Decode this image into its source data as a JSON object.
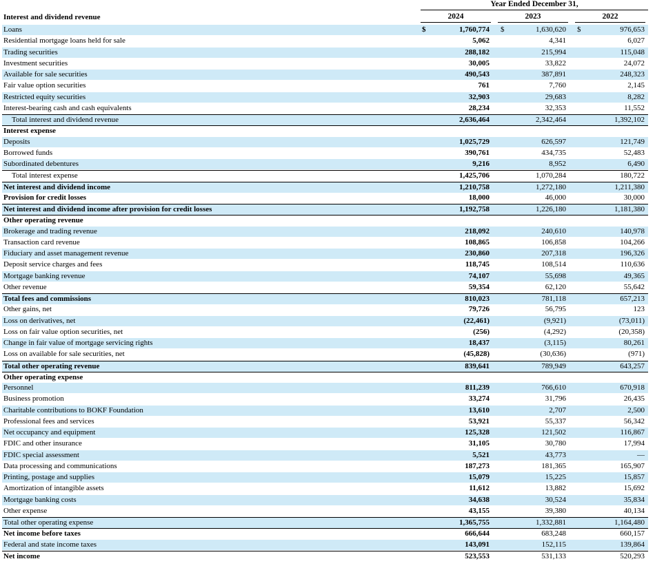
{
  "header": {
    "section_title": "Interest and dividend revenue",
    "period": "Year Ended December 31,",
    "years": [
      "2024",
      "2023",
      "2022"
    ],
    "dollar_sign": "$"
  },
  "rows": [
    {
      "label": "Loans",
      "v": [
        "1,760,774",
        "1,630,620",
        "976,653"
      ],
      "dollar": true
    },
    {
      "label": "Residential mortgage loans held for sale",
      "v": [
        "5,062",
        "4,341",
        "6,027"
      ]
    },
    {
      "label": "Trading securities",
      "v": [
        "288,182",
        "215,994",
        "115,048"
      ]
    },
    {
      "label": "Investment securities",
      "v": [
        "30,005",
        "33,822",
        "24,072"
      ]
    },
    {
      "label": "Available for sale securities",
      "v": [
        "490,543",
        "387,891",
        "248,323"
      ]
    },
    {
      "label": "Fair value option securities",
      "v": [
        "761",
        "7,760",
        "2,145"
      ]
    },
    {
      "label": "Restricted equity securities",
      "v": [
        "32,903",
        "29,683",
        "8,282"
      ]
    },
    {
      "label": "Interest-bearing cash and cash equivalents",
      "v": [
        "28,234",
        "32,353",
        "11,552"
      ]
    },
    {
      "label": "Total interest and dividend revenue",
      "v": [
        "2,636,464",
        "2,342,464",
        "1,392,102"
      ],
      "indent": true,
      "topline": true
    },
    {
      "label": "Interest expense",
      "v": [
        "",
        "",
        ""
      ],
      "bold": true,
      "topline": true
    },
    {
      "label": "Deposits",
      "v": [
        "1,025,729",
        "626,597",
        "121,749"
      ]
    },
    {
      "label": "Borrowed funds",
      "v": [
        "390,761",
        "434,735",
        "52,483"
      ]
    },
    {
      "label": "Subordinated debentures",
      "v": [
        "9,216",
        "8,952",
        "6,490"
      ]
    },
    {
      "label": "Total interest expense",
      "v": [
        "1,425,706",
        "1,070,284",
        "180,722"
      ],
      "indent": true,
      "topline": true
    },
    {
      "label": "Net interest and dividend income",
      "v": [
        "1,210,758",
        "1,272,180",
        "1,211,380"
      ],
      "bold": true,
      "topline": true
    },
    {
      "label": "Provision for credit losses",
      "v": [
        "18,000",
        "46,000",
        "30,000"
      ],
      "bold": true
    },
    {
      "label": "Net interest and dividend income after provision for credit losses",
      "v": [
        "1,192,758",
        "1,226,180",
        "1,181,380"
      ],
      "bold": true,
      "topline": true
    },
    {
      "label": "Other operating revenue",
      "v": [
        "",
        "",
        ""
      ],
      "bold": true,
      "topline": true
    },
    {
      "label": "Brokerage and trading revenue",
      "v": [
        "218,092",
        "240,610",
        "140,978"
      ]
    },
    {
      "label": "Transaction card revenue",
      "v": [
        "108,865",
        "106,858",
        "104,266"
      ]
    },
    {
      "label": "Fiduciary and asset management revenue",
      "v": [
        "230,860",
        "207,318",
        "196,326"
      ]
    },
    {
      "label": "Deposit service charges and fees",
      "v": [
        "118,745",
        "108,514",
        "110,636"
      ]
    },
    {
      "label": "Mortgage banking revenue",
      "v": [
        "74,107",
        "55,698",
        "49,365"
      ]
    },
    {
      "label": "Other revenue",
      "v": [
        "59,354",
        "62,120",
        "55,642"
      ]
    },
    {
      "label": "Total fees and commissions",
      "v": [
        "810,023",
        "781,118",
        "657,213"
      ],
      "bold": true,
      "topline": true
    },
    {
      "label": "Other gains, net",
      "v": [
        "79,726",
        "56,795",
        "123"
      ]
    },
    {
      "label": "Loss on derivatives, net",
      "v": [
        "(22,461)",
        "(9,921)",
        "(73,011)"
      ]
    },
    {
      "label": "Loss on fair value option securities, net",
      "v": [
        "(256)",
        "(4,292)",
        "(20,358)"
      ]
    },
    {
      "label": "Change in fair value of mortgage servicing rights",
      "v": [
        "18,437",
        "(3,115)",
        "80,261"
      ]
    },
    {
      "label": "Loss on available for sale securities, net",
      "v": [
        "(45,828)",
        "(30,636)",
        "(971)"
      ]
    },
    {
      "label": "Total other operating revenue",
      "v": [
        "839,641",
        "789,949",
        "643,257"
      ],
      "bold": true,
      "topline": true
    },
    {
      "label": "Other operating expense",
      "v": [
        "",
        "",
        ""
      ],
      "bold": true,
      "topline": true
    },
    {
      "label": "Personnel",
      "v": [
        "811,239",
        "766,610",
        "670,918"
      ]
    },
    {
      "label": "Business promotion",
      "v": [
        "33,274",
        "31,796",
        "26,435"
      ]
    },
    {
      "label": "Charitable contributions to BOKF Foundation",
      "v": [
        "13,610",
        "2,707",
        "2,500"
      ]
    },
    {
      "label": "Professional fees and services",
      "v": [
        "53,921",
        "55,337",
        "56,342"
      ]
    },
    {
      "label": "Net occupancy and equipment",
      "v": [
        "125,328",
        "121,502",
        "116,867"
      ]
    },
    {
      "label": "FDIC and other insurance",
      "v": [
        "31,105",
        "30,780",
        "17,994"
      ]
    },
    {
      "label": "FDIC special assessment",
      "v": [
        "5,521",
        "43,773",
        "—"
      ]
    },
    {
      "label": "Data processing and communications",
      "v": [
        "187,273",
        "181,365",
        "165,907"
      ]
    },
    {
      "label": "Printing, postage and supplies",
      "v": [
        "15,079",
        "15,225",
        "15,857"
      ]
    },
    {
      "label": "Amortization of intangible assets",
      "v": [
        "11,612",
        "13,882",
        "15,692"
      ]
    },
    {
      "label": "Mortgage banking costs",
      "v": [
        "34,638",
        "30,524",
        "35,834"
      ]
    },
    {
      "label": "Other expense",
      "v": [
        "43,155",
        "39,380",
        "40,134"
      ]
    },
    {
      "label": "Total other operating expense",
      "v": [
        "1,365,755",
        "1,332,881",
        "1,164,480"
      ],
      "topline": true
    },
    {
      "label": "Net income before taxes",
      "v": [
        "666,644",
        "683,248",
        "660,157"
      ],
      "bold": true,
      "topline": true
    },
    {
      "label": "Federal and state income taxes",
      "v": [
        "143,091",
        "152,115",
        "139,864"
      ]
    },
    {
      "label": "Net income",
      "v": [
        "523,553",
        "531,133",
        "520,293"
      ],
      "bold": true,
      "topline": true
    }
  ]
}
